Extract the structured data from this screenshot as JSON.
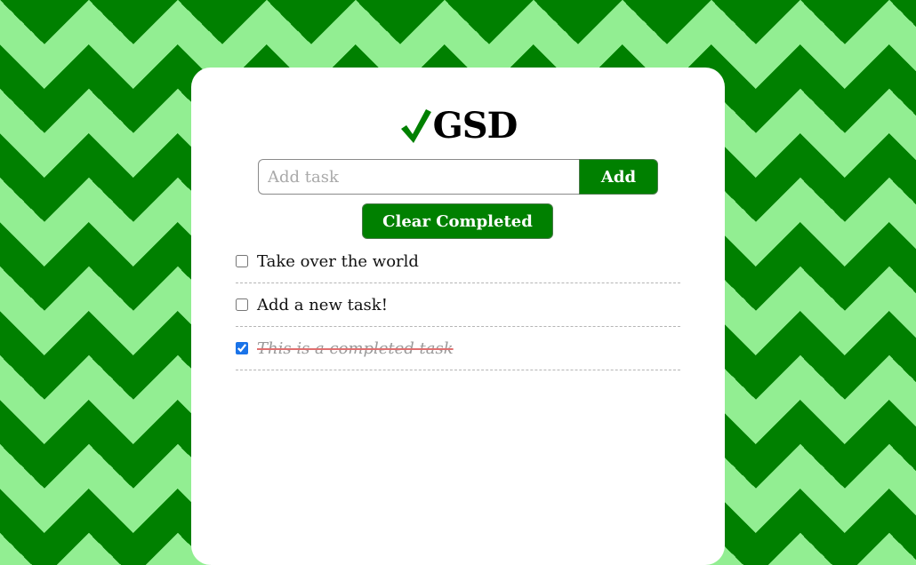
{
  "app": {
    "logo_text": "GSD",
    "logo_icon": "checkmark-icon"
  },
  "add_form": {
    "input_placeholder": "Add task",
    "input_value": "",
    "add_label": "Add"
  },
  "actions": {
    "clear_label": "Clear Completed"
  },
  "tasks": [
    {
      "label": "Take over the world",
      "completed": false
    },
    {
      "label": "Add a new task!",
      "completed": false
    },
    {
      "label": "This is a completed task",
      "completed": true
    }
  ],
  "colors": {
    "accent": "#008000",
    "background_light": "#92ee92",
    "background_dark": "#008000",
    "completed_strike": "#e07070",
    "checkbox": "#1a73e8"
  }
}
